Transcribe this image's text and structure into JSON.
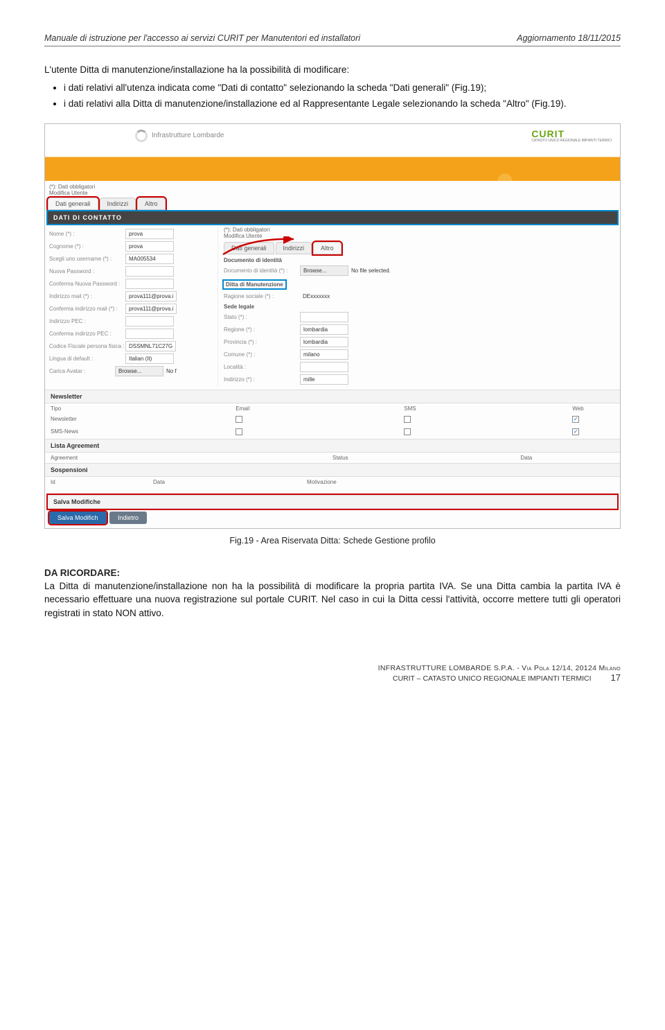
{
  "header": {
    "left": "Manuale di istruzione per l'accesso ai servizi CURIT per Manutentori ed installatori",
    "right": "Aggiornamento 18/11/2015"
  },
  "intro": "L'utente Ditta di manutenzione/installazione ha la possibilità di modificare:",
  "bullets": [
    "i dati relativi all'utenza indicata come \"Dati di contatto\" selezionando la scheda \"Dati generali\" (Fig.19);",
    "i dati relativi alla Ditta di manutenzione/installazione ed al Rappresentante Legale selezionando la scheda \"Altro\" (Fig.19)."
  ],
  "screenshot": {
    "logo_left": "Infrastrutture Lombarde",
    "logo_right": "CURIT",
    "logo_right_sub": "CATASTO UNICO REGIONALE IMPIANTI TERMICI",
    "obblig_note": "(*): Dati obbligatori\nModifica Utente",
    "outer_tabs": {
      "t1": "Dati generali",
      "t2": "Indirizzi",
      "t3": "Altro"
    },
    "panel_title": "DATI DI CONTATTO",
    "left_form": {
      "nome_l": "Nome (*) :",
      "nome_v": "prova",
      "cognome_l": "Cognome (*) :",
      "cognome_v": "prova",
      "user_l": "Scegli uno username (*) :",
      "user_v": "MA005534",
      "npass_l": "Nuova Password :",
      "cpass_l": "Conferma Nuova Password :",
      "mail_l": "Indirizzo mail (*) :",
      "mail_v": "prova111@prova.i",
      "cmail_l": "Conferma indirizzo mail (*) :",
      "cmail_v": "prova111@prova.i",
      "pec_l": "Indirizzo PEC :",
      "cpec_l": "Conferma indirizzo PEC :",
      "cf_l": "Codice Fiscale persona fisica :",
      "cf_v": "DSSMNL71C27G",
      "lang_l": "Lingua di default :",
      "lang_v": "Italian (It)",
      "avatar_l": "Carica Avatar :",
      "avatar_btn": "Browse...",
      "avatar_txt": "No f"
    },
    "inner_note": "(*): Dati obbligatori\nModifica Utente",
    "inner_tabs": {
      "t1": "Dati generali",
      "t2": "Indirizzi",
      "t3": "Altro"
    },
    "doc_title": "Documento di identità",
    "doc_label": "Documento di identità (*) :",
    "doc_browse": "Browse...",
    "doc_nofile": "No file selected.",
    "ditta_title": "Ditta di Manutenzione",
    "ragione_l": "Ragione sociale (*) :",
    "ragione_v": "DExxxxxxx",
    "sede_title": "Sede legale",
    "stato_l": "Stato (*) :",
    "regione_l": "Regione (*) :",
    "regione_v": "lombardia",
    "provincia_l": "Provincia (*) :",
    "provincia_v": "lombardia",
    "comune_l": "Comune (*) :",
    "comune_v": "milano",
    "localita_l": "Località :",
    "indirizzo_l": "Indirizzo (*) :",
    "indirizzo_v": "mille",
    "newsletter": {
      "title": "Newsletter",
      "h_tipo": "Tipo",
      "h_email": "Email",
      "h_sms": "SMS",
      "h_web": "Web",
      "r1": "Newsletter",
      "r2": "SMS-News"
    },
    "agreement": {
      "title": "Lista Agreement",
      "h1": "Agreement",
      "h2": "Status",
      "h3": "Data"
    },
    "sosp": {
      "title": "Sospensioni",
      "h1": "Id",
      "h2": "Data",
      "h3": "Motivazione"
    },
    "save_title": "Salva Modifiche",
    "btn_save": "Salva Modifich",
    "btn_back": "Indietro"
  },
  "caption": "Fig.19 - Area Riservata Ditta: Schede Gestione profilo",
  "da_ric_title": "DA RICORDARE:",
  "da_ric_body": "La Ditta di manutenzione/installazione non ha la possibilità di modificare la propria partita IVA. Se una Ditta cambia la partita IVA è necessario effettuare una nuova registrazione sul portale CURIT. Nel caso in cui la Ditta cessi l'attività, occorre mettere tutti gli operatori registrati in stato NON attivo.",
  "footer": {
    "l1": "INFRASTRUTTURE LOMBARDE S.P.A. - Via Pola 12/14, 20124 Milano",
    "l2": "CURIT – CATASTO UNICO REGIONALE IMPIANTI TERMICI",
    "pagenum": "17"
  }
}
